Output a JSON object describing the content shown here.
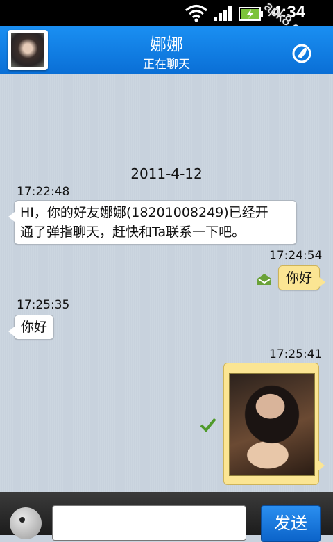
{
  "status_bar": {
    "time": "4:34",
    "watermark": "apk8.com"
  },
  "header": {
    "contact_name": "娜娜",
    "status": "正在聊天"
  },
  "chat": {
    "date": "2011-4-12",
    "messages": [
      {
        "time": "17:22:48",
        "direction": "incoming",
        "text": "HI，你的好友娜娜(18201008249)已经开",
        "text2": "通了弹指聊天，赶快和Ta联系一下吧。"
      },
      {
        "time": "17:24:54",
        "direction": "outgoing",
        "text": "你好"
      },
      {
        "time": "17:25:35",
        "direction": "incoming",
        "text": "你好"
      },
      {
        "time": "17:25:41",
        "direction": "outgoing",
        "text": ""
      }
    ]
  },
  "input": {
    "placeholder": "",
    "send_label": "发送"
  },
  "colors": {
    "header": "#0a7ae0",
    "outgoing_bubble": "#fbe593",
    "incoming_bubble": "#ffffff"
  },
  "icons": [
    "wifi-icon",
    "signal-icon",
    "battery-icon",
    "attach-icon",
    "read-receipt-icon",
    "sent-check-icon",
    "emoji-icon"
  ]
}
